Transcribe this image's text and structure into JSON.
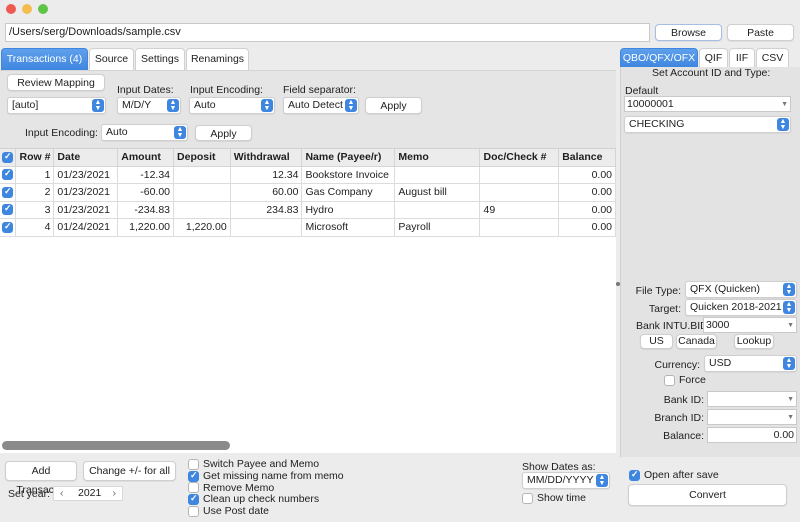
{
  "window": {
    "controls": [
      "close",
      "minimize",
      "zoom"
    ]
  },
  "file": {
    "path": "/Users/serg/Downloads/sample.csv",
    "browse_label": "Browse",
    "paste_label": "Paste"
  },
  "tabs": [
    {
      "label": "Transactions (4)",
      "active": true
    },
    {
      "label": "Source",
      "active": false
    },
    {
      "label": "Settings",
      "active": false
    },
    {
      "label": "Renamings",
      "active": false
    }
  ],
  "mapping": {
    "review_label": "Review Mapping",
    "mapping_value": "[auto]",
    "input_dates_label": "Input Dates:",
    "input_dates_value": "M/D/Y",
    "input_encoding_label": "Input Encoding:",
    "input_encoding_value": "Auto",
    "field_separator_label": "Field separator:",
    "field_separator_value": "Auto Detect",
    "apply_label": "Apply",
    "input_encoding2_label": "Input Encoding:",
    "input_encoding2_value": "Auto",
    "apply2_label": "Apply"
  },
  "table": {
    "columns": [
      "Row #",
      "Date",
      "Amount",
      "Deposit",
      "Withdrawal",
      "Name (Payee/r)",
      "Memo",
      "Doc/Check #",
      "Balance"
    ],
    "rows": [
      {
        "checked": true,
        "row": "1",
        "date": "01/23/2021",
        "amount": "-12.34",
        "deposit": "",
        "withdrawal": "12.34",
        "name": "Bookstore Invoice",
        "memo": "",
        "doc": "",
        "balance": "0.00"
      },
      {
        "checked": true,
        "row": "2",
        "date": "01/23/2021",
        "amount": "-60.00",
        "deposit": "",
        "withdrawal": "60.00",
        "name": "Gas Company",
        "memo": "August bill",
        "doc": "",
        "balance": "0.00"
      },
      {
        "checked": true,
        "row": "3",
        "date": "01/23/2021",
        "amount": "-234.83",
        "deposit": "",
        "withdrawal": "234.83",
        "name": "Hydro",
        "memo": "",
        "doc": "49",
        "balance": "0.00"
      },
      {
        "checked": true,
        "row": "4",
        "date": "01/24/2021",
        "amount": "1,220.00",
        "deposit": "1,220.00",
        "withdrawal": "",
        "name": "Microsoft",
        "memo": "Payroll",
        "doc": "",
        "balance": "0.00"
      }
    ]
  },
  "bottom": {
    "add_label": "Add Transact...",
    "change_sign_label": "Change +/- for all",
    "set_year_label": "Set year:",
    "year_value": "2021",
    "options": [
      {
        "label": "Switch Payee and Memo",
        "checked": false
      },
      {
        "label": "Get missing name from memo",
        "checked": true
      },
      {
        "label": "Remove Memo",
        "checked": false
      },
      {
        "label": "Clean up check numbers",
        "checked": true
      },
      {
        "label": "Use Post date",
        "checked": false
      }
    ],
    "show_dates_label": "Show Dates as:",
    "show_dates_value": "MM/DD/YYYY",
    "show_time_label": "Show time",
    "show_time_checked": false
  },
  "right": {
    "tabs": [
      {
        "label": "QBO/QFX/OFX",
        "active": true
      },
      {
        "label": "QIF",
        "active": false
      },
      {
        "label": "IIF",
        "active": false
      },
      {
        "label": "CSV",
        "active": false
      }
    ],
    "set_account_label": "Set Account ID and Type:",
    "default_label": "Default",
    "account_id": "10000001",
    "account_type": "CHECKING",
    "file_type_label": "File Type:",
    "file_type_value": "QFX (Quicken)",
    "target_label": "Target:",
    "target_value": "Quicken 2018-2021",
    "bank_intu_label": "Bank INTU.BID",
    "bank_intu_value": "3000",
    "us_label": "US",
    "canada_label": "Canada",
    "lookup_label": "Lookup",
    "currency_label": "Currency:",
    "currency_value": "USD",
    "force_label": "Force",
    "force_checked": false,
    "bank_id_label": "Bank ID:",
    "bank_id_value": "",
    "branch_id_label": "Branch ID:",
    "branch_id_value": "",
    "balance_label": "Balance:",
    "balance_value": "0.00",
    "open_after_save_label": "Open after save",
    "open_after_save_checked": true,
    "convert_label": "Convert"
  },
  "colors": {
    "accent": "#3f86e0",
    "close": "#ee5a52",
    "minimize": "#f4be4f",
    "zoom": "#5ec548"
  }
}
